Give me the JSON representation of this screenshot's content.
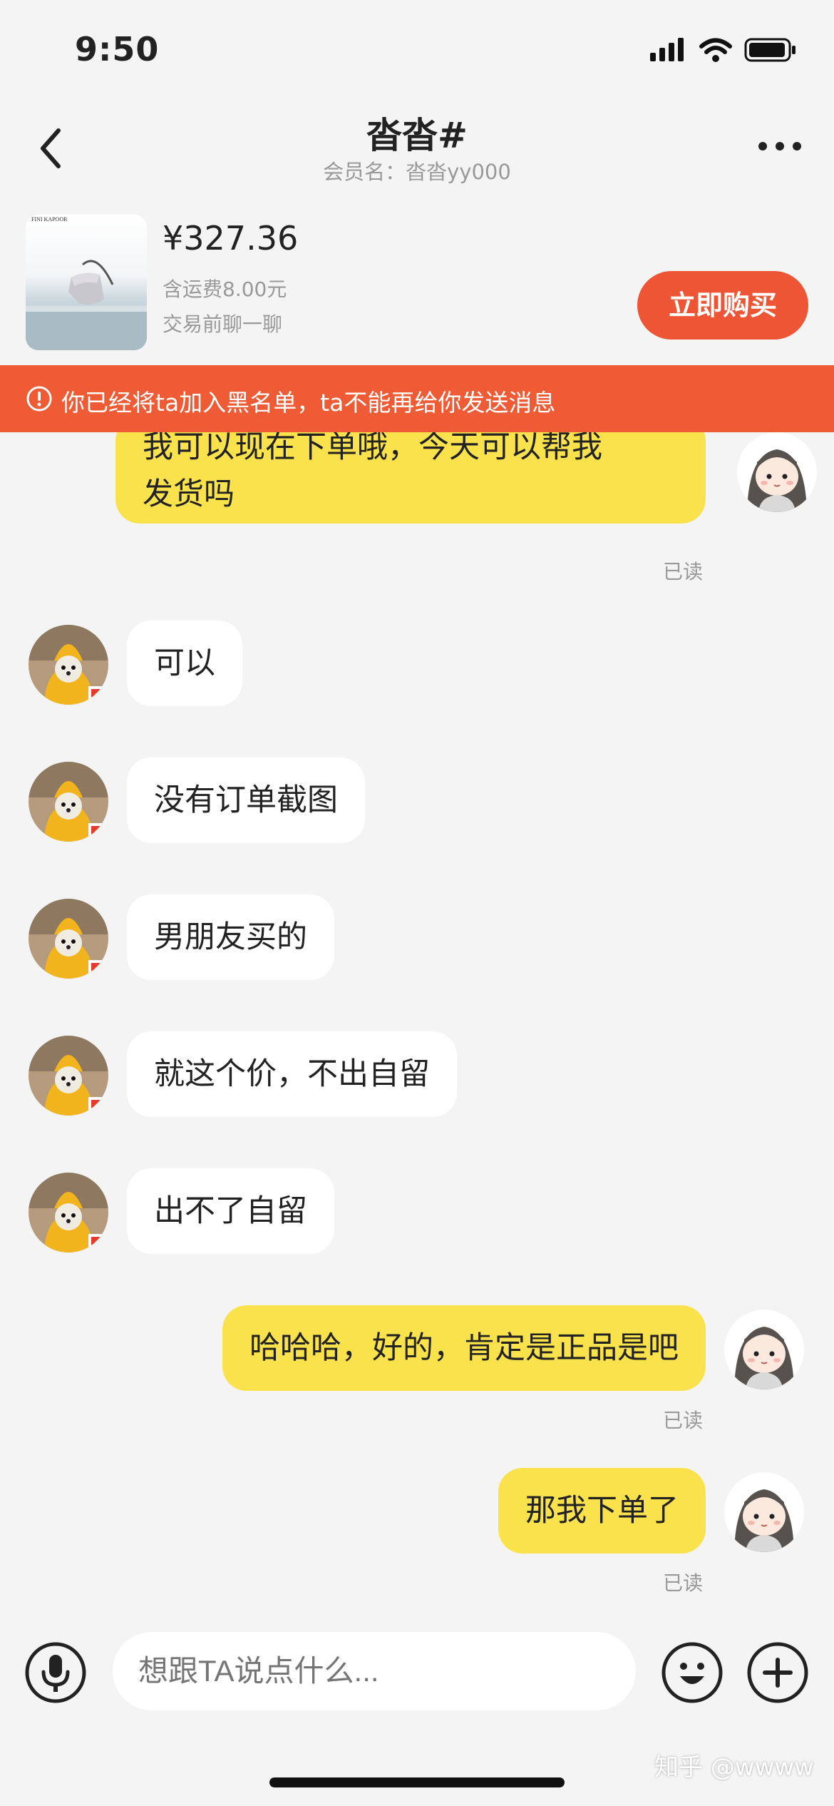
{
  "status_bar": {
    "time": "9:50"
  },
  "header": {
    "title": "沓沓#",
    "subtitle": "会员名：沓沓yy000"
  },
  "product": {
    "brand": "FINI KAPOOR",
    "price": "¥327.36",
    "freight": "含运费8.00元",
    "prechat": "交易前聊一聊",
    "buy_label": "立即购买"
  },
  "banner": {
    "text": "你已经将ta加入黑名单，ta不能再给你发送消息"
  },
  "messages": [
    {
      "side": "me",
      "line1": "我可以现在下单哦，今天可以帮我",
      "line2": "发货吗",
      "read": "已读"
    },
    {
      "side": "other",
      "text": "可以"
    },
    {
      "side": "other",
      "text": "没有订单截图"
    },
    {
      "side": "other",
      "text": "男朋友买的"
    },
    {
      "side": "other",
      "text": "就这个价，不出自留"
    },
    {
      "side": "other",
      "text": "出不了自留"
    },
    {
      "side": "me",
      "text": "哈哈哈，好的，肯定是正品是吧",
      "read": "已读"
    },
    {
      "side": "me",
      "text": "那我下单了",
      "read": "已读"
    }
  ],
  "input": {
    "placeholder": "想跟TA说点什么..."
  },
  "watermark": "知乎 @wwww",
  "colors": {
    "accent": "#ee5535",
    "banner": "#ee5b35",
    "my_bubble": "#fae24c",
    "their_bubble": "#ffffff"
  }
}
